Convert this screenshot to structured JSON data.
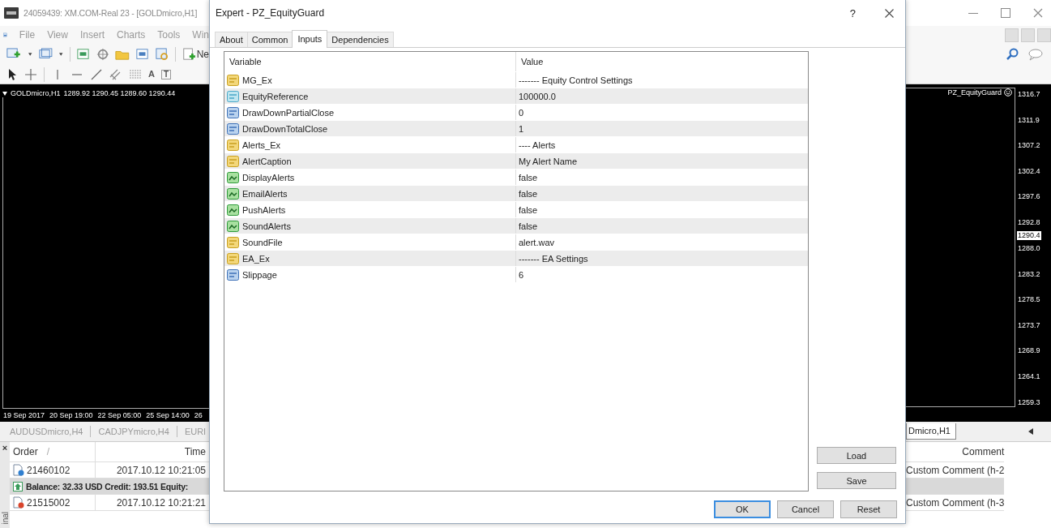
{
  "app": {
    "title": "24059439: XM.COM-Real 23 - [GOLDmicro,H1]",
    "menu": [
      "File",
      "View",
      "Insert",
      "Charts",
      "Tools",
      "Win"
    ],
    "toolbar_label": "Ne",
    "text_tool_glyph": "A",
    "label_tool_glyph": "T",
    "chart": {
      "symbol": "GOLDmicro,H1",
      "ohlc": "1289.92 1290.45 1289.60 1290.44",
      "indicator": "PZ_EquityGuard",
      "price_axis": [
        {
          "label": "1316.7",
          "kind": "tick"
        },
        {
          "label": "1311.9",
          "kind": "tick"
        },
        {
          "label": "1307.2",
          "kind": "tick"
        },
        {
          "label": "1302.4",
          "kind": "tick"
        },
        {
          "label": "1297.6",
          "kind": "tick"
        },
        {
          "label": "1292.8",
          "kind": "tick"
        },
        {
          "label": "1290.4",
          "kind": "current"
        },
        {
          "label": "1288.0",
          "kind": "tick"
        },
        {
          "label": "1283.2",
          "kind": "tick"
        },
        {
          "label": "1278.5",
          "kind": "tick"
        },
        {
          "label": "1273.7",
          "kind": "tick"
        },
        {
          "label": "1268.9",
          "kind": "tick"
        },
        {
          "label": "1264.1",
          "kind": "tick"
        },
        {
          "label": "1259.3",
          "kind": "tick"
        }
      ],
      "time_axis": [
        "19 Sep 2017",
        "20 Sep 19:00",
        "22 Sep 05:00",
        "25 Sep 14:00",
        "26"
      ]
    },
    "chart_tabs": [
      {
        "label": "AUDUSDmicro,H4",
        "selected": false
      },
      {
        "label": "CADJPYmicro,H4",
        "selected": false
      },
      {
        "label": "EURI",
        "selected": false
      },
      {
        "label": "Dmicro,H1",
        "selected": true
      }
    ],
    "terminal": {
      "side_label": "inal",
      "close": "×",
      "columns": [
        {
          "label": "Order",
          "sort_mark": "/"
        },
        {
          "label": "Time"
        },
        {
          "label": "Comment"
        }
      ],
      "rows": [
        {
          "kind": "order",
          "color": "#2f7fd0",
          "order": "21460102",
          "time": "2017.10.12 10:21:05",
          "comment": "Custom Comment (h-2"
        },
        {
          "kind": "balance",
          "text": "Balance: 32.33 USD  Credit: 193.51  Equity:"
        },
        {
          "kind": "order",
          "color": "#d9452c",
          "order": "21515002",
          "time": "2017.10.12 10:21:21",
          "comment": "Custom Comment (h-3"
        }
      ]
    }
  },
  "dialog": {
    "title": "Expert - PZ_EquityGuard",
    "help": "?",
    "tabs": [
      {
        "label": "About",
        "selected": false
      },
      {
        "label": "Common",
        "selected": false
      },
      {
        "label": "Inputs",
        "selected": true
      },
      {
        "label": "Dependencies",
        "selected": false
      }
    ],
    "columns": [
      "Variable",
      "Value"
    ],
    "rows": [
      {
        "kind": "string",
        "variable": "MG_Ex",
        "value": "------- Equity Control Settings"
      },
      {
        "kind": "double",
        "variable": "EquityReference",
        "value": "100000.0"
      },
      {
        "kind": "int",
        "variable": "DrawDownPartialClose",
        "value": "0"
      },
      {
        "kind": "int",
        "variable": "DrawDownTotalClose",
        "value": "1"
      },
      {
        "kind": "string",
        "variable": "Alerts_Ex",
        "value": "---- Alerts"
      },
      {
        "kind": "string",
        "variable": "AlertCaption",
        "value": "My Alert Name"
      },
      {
        "kind": "bool",
        "variable": "DisplayAlerts",
        "value": "false"
      },
      {
        "kind": "bool",
        "variable": "EmailAlerts",
        "value": "false"
      },
      {
        "kind": "bool",
        "variable": "PushAlerts",
        "value": "false"
      },
      {
        "kind": "bool",
        "variable": "SoundAlerts",
        "value": "false"
      },
      {
        "kind": "string",
        "variable": "SoundFile",
        "value": "alert.wav"
      },
      {
        "kind": "string",
        "variable": "EA_Ex",
        "value": "------- EA Settings"
      },
      {
        "kind": "int",
        "variable": "Slippage",
        "value": "6"
      }
    ],
    "side_buttons": [
      "Load",
      "Save"
    ],
    "buttons": [
      {
        "label": "OK",
        "default": true
      },
      {
        "label": "Cancel",
        "default": false
      },
      {
        "label": "Reset",
        "default": false
      }
    ]
  }
}
